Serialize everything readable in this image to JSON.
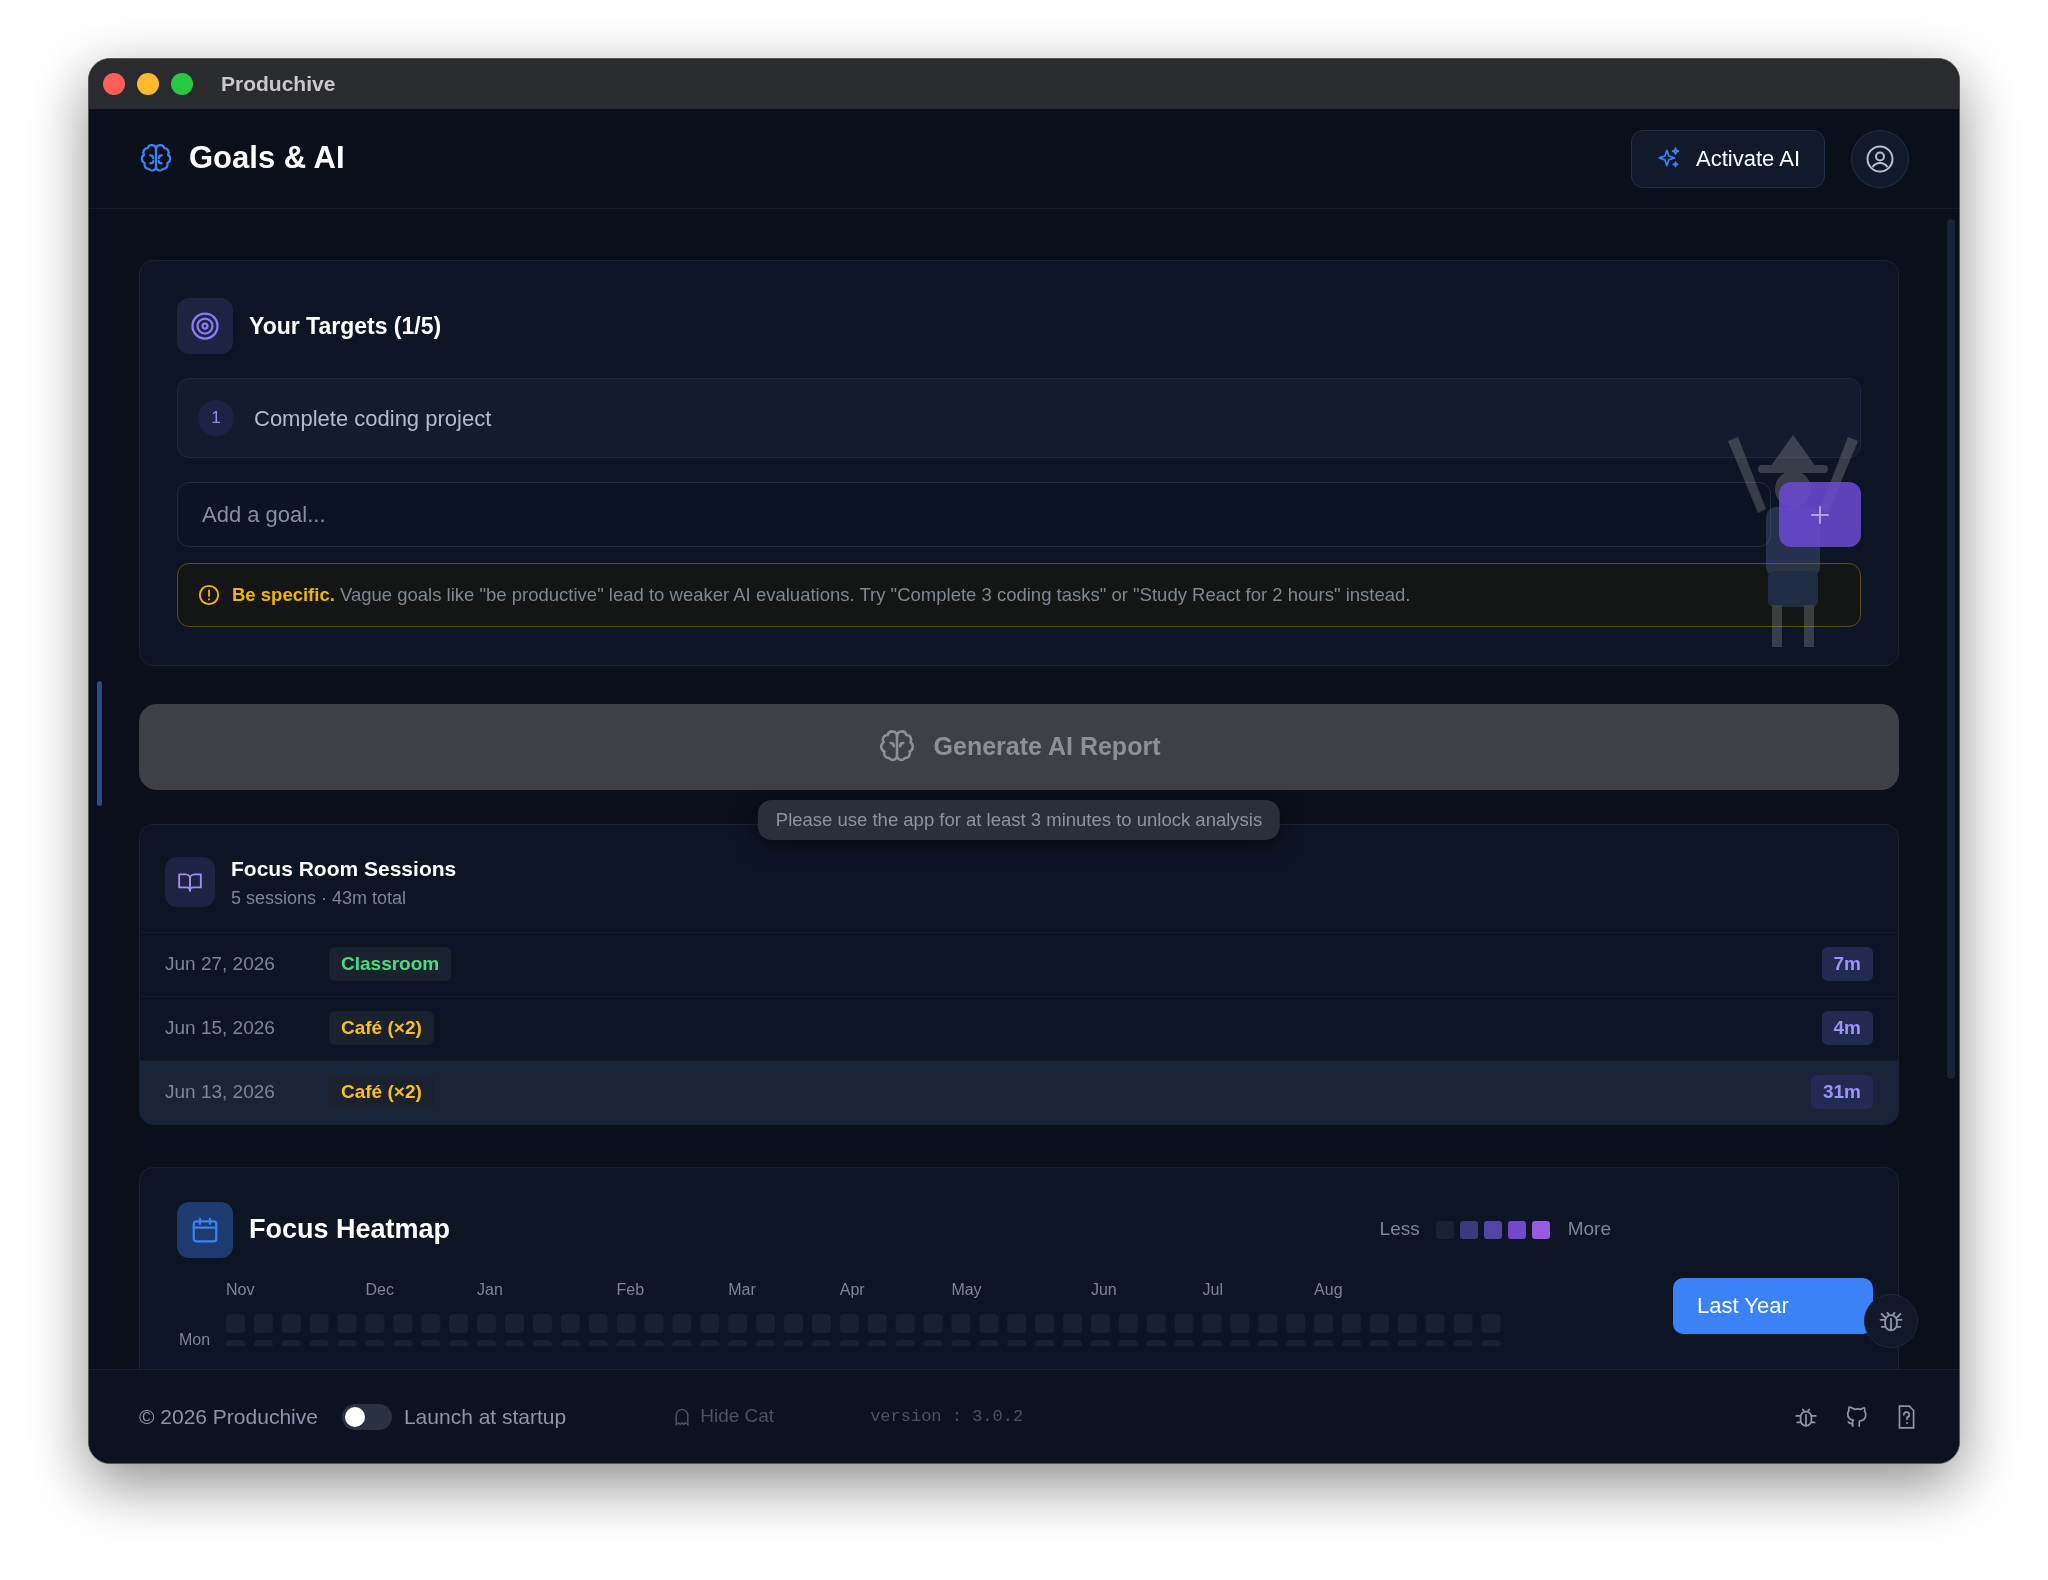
{
  "window": {
    "title": "Produchive"
  },
  "header": {
    "title": "Goals & AI",
    "activate_button": "Activate AI"
  },
  "targets": {
    "title": "Your Targets (1/5)",
    "goals": [
      {
        "number": "1",
        "text": "Complete coding project"
      }
    ],
    "input": {
      "placeholder": "Add a goal..."
    },
    "tip": "**Be specific.** Vague goals like \"be productive\" lead to weaker AI evaluations. Try \"Complete 3 coding tasks\" or \"Study React for 2 hours\" instead."
  },
  "generate_button": {
    "label": "Generate AI Report",
    "disabled": true
  },
  "tooltip": "Please use the app for at least 3 minutes to unlock analysis",
  "sessions": {
    "title": "Focus Room Sessions",
    "subtitle": "5 sessions · 43m total",
    "rows": [
      {
        "date": "Jun 27, 2026",
        "room": "Classroom",
        "color": "#4ade80",
        "duration": "7m",
        "selected": false
      },
      {
        "date": "Jun 15, 2026",
        "room": "Café (×2)",
        "color": "#fbbf24",
        "duration": "4m",
        "selected": false
      },
      {
        "date": "Jun 13, 2026",
        "room": "Café (×2)",
        "color": "#fbbf24",
        "duration": "31m",
        "selected": true
      }
    ]
  },
  "heatmap": {
    "title": "Focus Heatmap",
    "legend_less": "Less",
    "legend_more": "More",
    "months": [
      "Nov",
      "Dec",
      "Jan",
      "Feb",
      "Mar",
      "Apr",
      "May",
      "Jun",
      "Jul",
      "Aug"
    ],
    "day_label": "Mon",
    "range_button": "Last Year"
  },
  "footer": {
    "copyright": "© 2026 Produchive",
    "launch_at_startup": {
      "label": "Launch at startup",
      "on": false
    },
    "hide_cat": "Hide Cat",
    "version": "version : 3.0.2"
  }
}
